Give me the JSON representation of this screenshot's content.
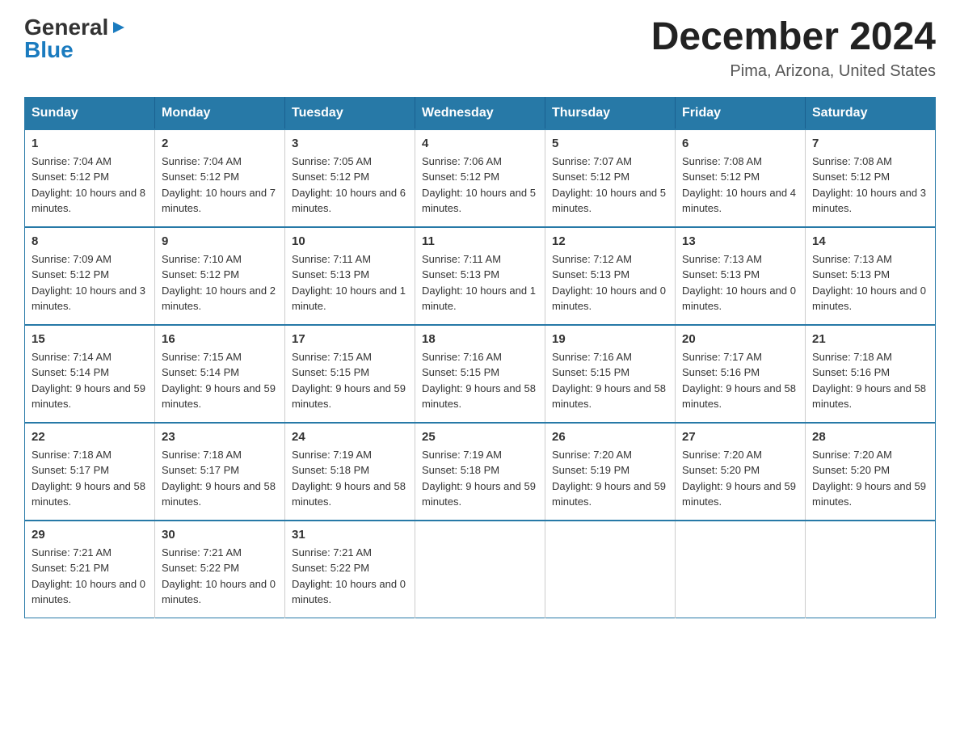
{
  "logo": {
    "general": "General",
    "blue": "Blue"
  },
  "title": {
    "month_year": "December 2024",
    "location": "Pima, Arizona, United States"
  },
  "days_of_week": [
    "Sunday",
    "Monday",
    "Tuesday",
    "Wednesday",
    "Thursday",
    "Friday",
    "Saturday"
  ],
  "weeks": [
    [
      {
        "day": "1",
        "sunrise": "7:04 AM",
        "sunset": "5:12 PM",
        "daylight": "10 hours and 8 minutes."
      },
      {
        "day": "2",
        "sunrise": "7:04 AM",
        "sunset": "5:12 PM",
        "daylight": "10 hours and 7 minutes."
      },
      {
        "day": "3",
        "sunrise": "7:05 AM",
        "sunset": "5:12 PM",
        "daylight": "10 hours and 6 minutes."
      },
      {
        "day": "4",
        "sunrise": "7:06 AM",
        "sunset": "5:12 PM",
        "daylight": "10 hours and 5 minutes."
      },
      {
        "day": "5",
        "sunrise": "7:07 AM",
        "sunset": "5:12 PM",
        "daylight": "10 hours and 5 minutes."
      },
      {
        "day": "6",
        "sunrise": "7:08 AM",
        "sunset": "5:12 PM",
        "daylight": "10 hours and 4 minutes."
      },
      {
        "day": "7",
        "sunrise": "7:08 AM",
        "sunset": "5:12 PM",
        "daylight": "10 hours and 3 minutes."
      }
    ],
    [
      {
        "day": "8",
        "sunrise": "7:09 AM",
        "sunset": "5:12 PM",
        "daylight": "10 hours and 3 minutes."
      },
      {
        "day": "9",
        "sunrise": "7:10 AM",
        "sunset": "5:12 PM",
        "daylight": "10 hours and 2 minutes."
      },
      {
        "day": "10",
        "sunrise": "7:11 AM",
        "sunset": "5:13 PM",
        "daylight": "10 hours and 1 minute."
      },
      {
        "day": "11",
        "sunrise": "7:11 AM",
        "sunset": "5:13 PM",
        "daylight": "10 hours and 1 minute."
      },
      {
        "day": "12",
        "sunrise": "7:12 AM",
        "sunset": "5:13 PM",
        "daylight": "10 hours and 0 minutes."
      },
      {
        "day": "13",
        "sunrise": "7:13 AM",
        "sunset": "5:13 PM",
        "daylight": "10 hours and 0 minutes."
      },
      {
        "day": "14",
        "sunrise": "7:13 AM",
        "sunset": "5:13 PM",
        "daylight": "10 hours and 0 minutes."
      }
    ],
    [
      {
        "day": "15",
        "sunrise": "7:14 AM",
        "sunset": "5:14 PM",
        "daylight": "9 hours and 59 minutes."
      },
      {
        "day": "16",
        "sunrise": "7:15 AM",
        "sunset": "5:14 PM",
        "daylight": "9 hours and 59 minutes."
      },
      {
        "day": "17",
        "sunrise": "7:15 AM",
        "sunset": "5:15 PM",
        "daylight": "9 hours and 59 minutes."
      },
      {
        "day": "18",
        "sunrise": "7:16 AM",
        "sunset": "5:15 PM",
        "daylight": "9 hours and 58 minutes."
      },
      {
        "day": "19",
        "sunrise": "7:16 AM",
        "sunset": "5:15 PM",
        "daylight": "9 hours and 58 minutes."
      },
      {
        "day": "20",
        "sunrise": "7:17 AM",
        "sunset": "5:16 PM",
        "daylight": "9 hours and 58 minutes."
      },
      {
        "day": "21",
        "sunrise": "7:18 AM",
        "sunset": "5:16 PM",
        "daylight": "9 hours and 58 minutes."
      }
    ],
    [
      {
        "day": "22",
        "sunrise": "7:18 AM",
        "sunset": "5:17 PM",
        "daylight": "9 hours and 58 minutes."
      },
      {
        "day": "23",
        "sunrise": "7:18 AM",
        "sunset": "5:17 PM",
        "daylight": "9 hours and 58 minutes."
      },
      {
        "day": "24",
        "sunrise": "7:19 AM",
        "sunset": "5:18 PM",
        "daylight": "9 hours and 58 minutes."
      },
      {
        "day": "25",
        "sunrise": "7:19 AM",
        "sunset": "5:18 PM",
        "daylight": "9 hours and 59 minutes."
      },
      {
        "day": "26",
        "sunrise": "7:20 AM",
        "sunset": "5:19 PM",
        "daylight": "9 hours and 59 minutes."
      },
      {
        "day": "27",
        "sunrise": "7:20 AM",
        "sunset": "5:20 PM",
        "daylight": "9 hours and 59 minutes."
      },
      {
        "day": "28",
        "sunrise": "7:20 AM",
        "sunset": "5:20 PM",
        "daylight": "9 hours and 59 minutes."
      }
    ],
    [
      {
        "day": "29",
        "sunrise": "7:21 AM",
        "sunset": "5:21 PM",
        "daylight": "10 hours and 0 minutes."
      },
      {
        "day": "30",
        "sunrise": "7:21 AM",
        "sunset": "5:22 PM",
        "daylight": "10 hours and 0 minutes."
      },
      {
        "day": "31",
        "sunrise": "7:21 AM",
        "sunset": "5:22 PM",
        "daylight": "10 hours and 0 minutes."
      },
      null,
      null,
      null,
      null
    ]
  ],
  "labels": {
    "sunrise": "Sunrise:",
    "sunset": "Sunset:",
    "daylight": "Daylight:"
  }
}
